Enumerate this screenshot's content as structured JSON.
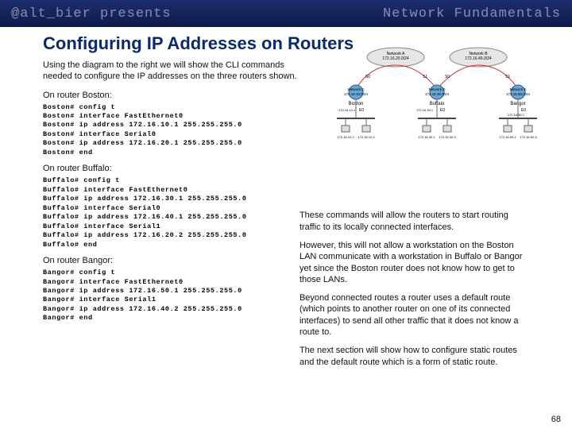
{
  "banner": {
    "left": "@alt_bier presents",
    "right": "Network Fundamentals"
  },
  "title": "Configuring IP Addresses on Routers",
  "intro": "Using the diagram to the right we will show the CLI commands needed to configure the IP addresses on the three routers shown.",
  "sections": {
    "boston": {
      "label": "On router Boston:",
      "cli": "Boston# config t\nBoston# interface FastEthernet0\nBoston# ip address 172.16.10.1 255.255.255.0\nBoston# interface Serial0\nBoston# ip address 172.16.20.1 255.255.255.0\nBoston# end"
    },
    "buffalo": {
      "label": "On router Buffalo:",
      "cli": "Buffalo# config t\nBuffalo# interface FastEthernet0\nBuffalo# ip address 172.16.30.1 255.255.255.0\nBuffalo# interface Serial0\nBuffalo# ip address 172.16.40.1 255.255.255.0\nBuffalo# interface Serial1\nBuffalo# ip address 172.16.20.2 255.255.255.0\nBuffalo# end"
    },
    "bangor": {
      "label": "On router Bangor:",
      "cli": "Bangor# config t\nBangor# interface FastEthernet0\nBangor# ip address 172.16.50.1 255.255.255.0\nBangor# interface Serial1\nBangor# ip address 172.16.40.2 255.255.255.0\nBangor# end"
    }
  },
  "paragraphs": {
    "p1": "These commands will allow the routers to start routing traffic to its locally connected interfaces.",
    "p2": "However, this will not allow a workstation on the Boston LAN communicate with a workstation in Buffalo or Bangor yet since the Boston router does not know how to get to those LANs.",
    "p3": "Beyond connected routes a router uses a default route (which points to another router on one of its connected interfaces) to send all other traffic that it does not know a route to.",
    "p4": "The next section will show how to configure static routes and the default route which is a form of static route."
  },
  "diagram": {
    "netA": "Network A\n172.16.20.0/24",
    "netB": "Network B\n172.16.40.0/24",
    "netC": "Network C\n172.16.10.0/24",
    "netD": "Network D\n172.16.30.0/24",
    "netE": "Network E\n172.16.50.0/24",
    "router1": "Boston",
    "router2": "Buffalo",
    "router3": "Bangor",
    "s0": "S0",
    "s1": "S1",
    "e0": "E0",
    "ip_c_router": "172.16.10.1",
    "ip_d_router": "172.16.30.1",
    "ip_e_router": "172.16.50.1",
    "hostC1": "172.16.10.2",
    "hostC2": "172.16.10.3",
    "hostD1": "172.16.30.2",
    "hostD2": "172.16.30.3",
    "hostE1": "172.16.50.2",
    "hostE2": "172.16.50.3"
  },
  "page": "68"
}
